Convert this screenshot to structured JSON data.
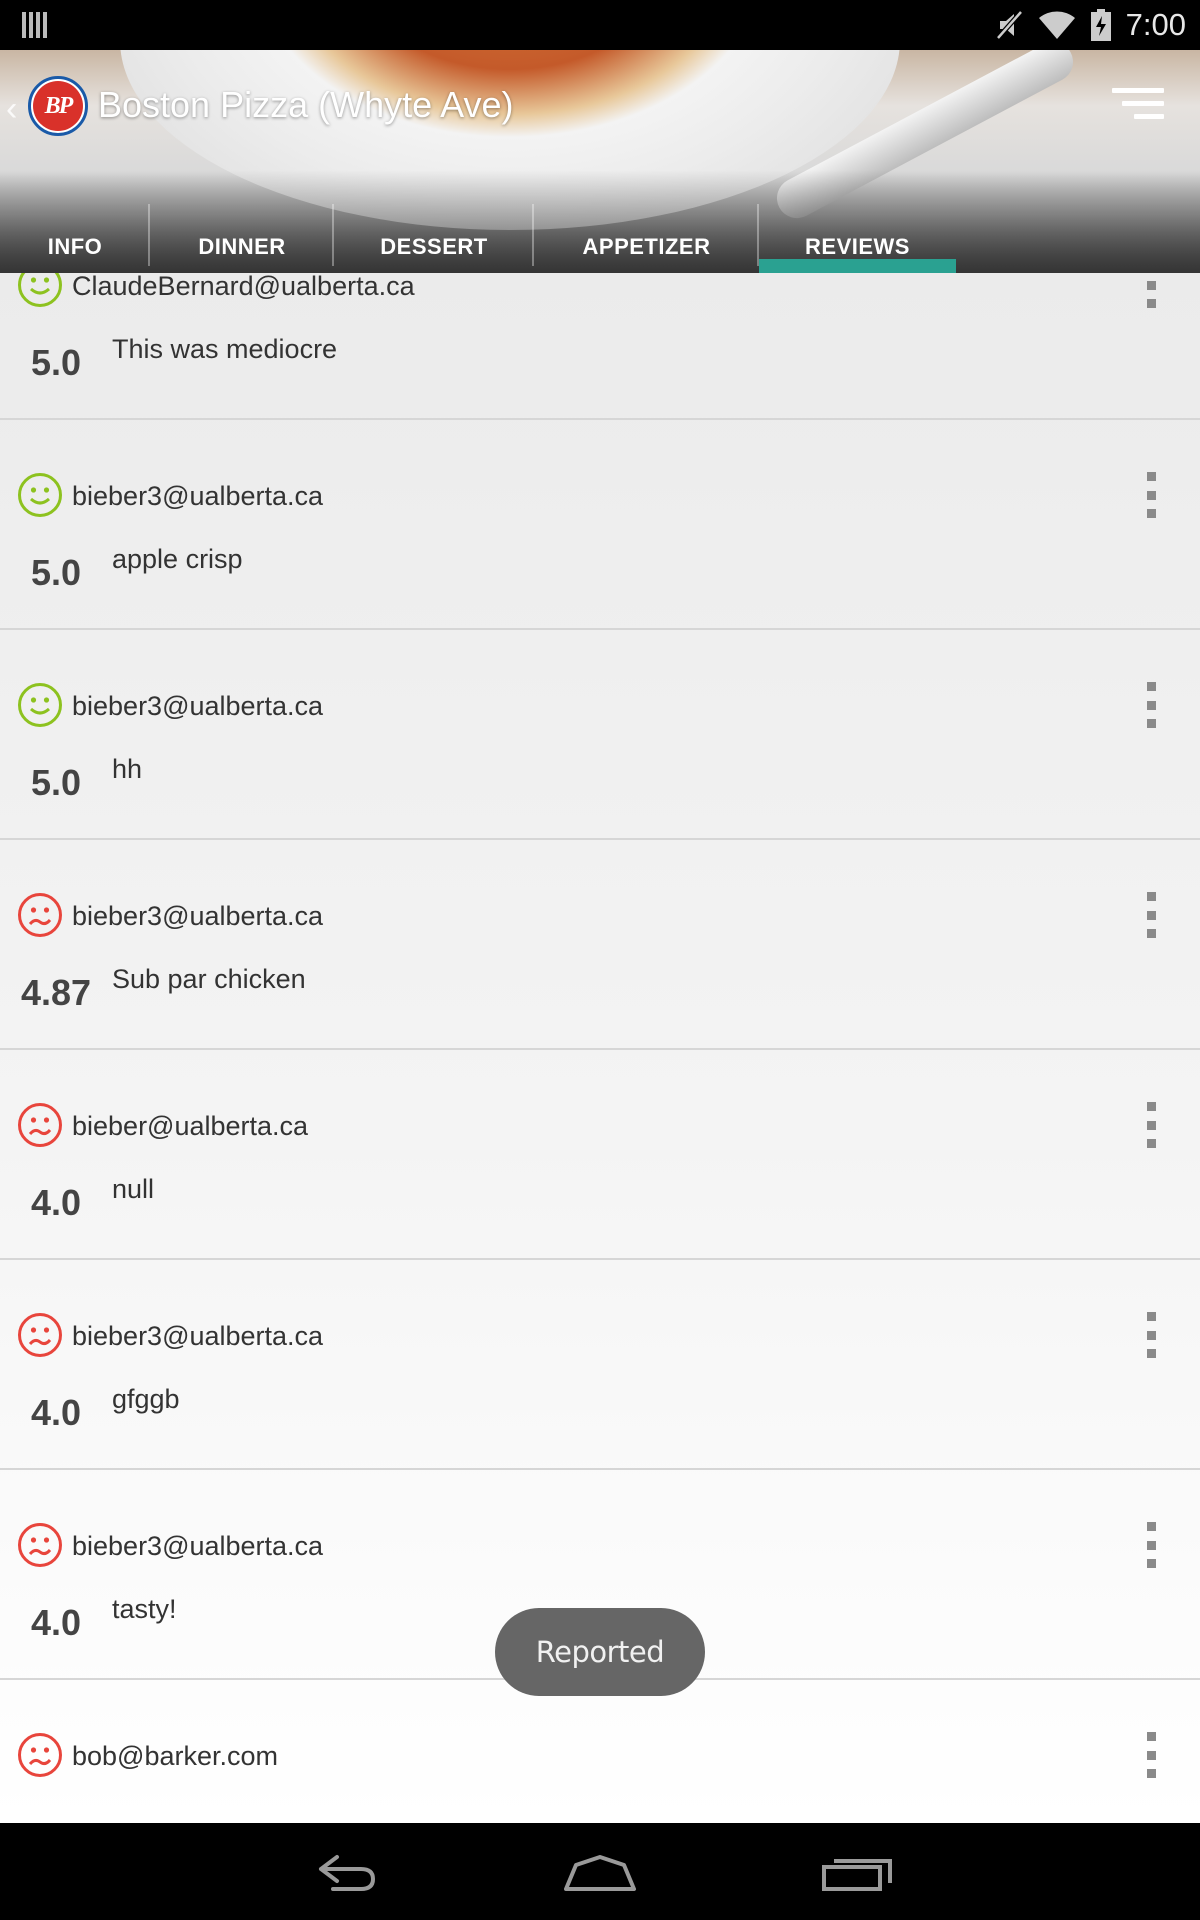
{
  "status_bar": {
    "time": "7:00",
    "icons": [
      "barcode-icon",
      "mute-icon",
      "wifi-icon",
      "battery-charging-icon"
    ]
  },
  "header": {
    "title": "Boston Pizza (Whyte Ave)",
    "logo_text": "BP",
    "menu_icon": "sort-menu-icon"
  },
  "tabs": [
    {
      "label": "INFO",
      "active": false
    },
    {
      "label": "DINNER",
      "active": false
    },
    {
      "label": "DESSERT",
      "active": false
    },
    {
      "label": "APPETIZER",
      "active": false
    },
    {
      "label": "REVIEWS",
      "active": true
    }
  ],
  "colors": {
    "accent": "#2aa191",
    "happy": "#8dc21f",
    "sad": "#e8453c"
  },
  "reviews": [
    {
      "email": "ClaudeBernard@ualberta.ca",
      "rating": "5.0",
      "comment": "This was mediocre",
      "sentiment": "happy"
    },
    {
      "email": "bieber3@ualberta.ca",
      "rating": "5.0",
      "comment": "apple crisp",
      "sentiment": "happy"
    },
    {
      "email": "bieber3@ualberta.ca",
      "rating": "5.0",
      "comment": "hh",
      "sentiment": "happy"
    },
    {
      "email": "bieber3@ualberta.ca",
      "rating": "4.87",
      "comment": "Sub par chicken",
      "sentiment": "sad"
    },
    {
      "email": "bieber@ualberta.ca",
      "rating": "4.0",
      "comment": "null",
      "sentiment": "sad"
    },
    {
      "email": "bieber3@ualberta.ca",
      "rating": "4.0",
      "comment": "gfggb",
      "sentiment": "sad"
    },
    {
      "email": "bieber3@ualberta.ca",
      "rating": "4.0",
      "comment": "tasty!",
      "sentiment": "sad"
    },
    {
      "email": "bob@barker.com",
      "rating": "",
      "comment": "",
      "sentiment": "sad"
    }
  ],
  "toast": "Reported",
  "nav_bar": [
    "back-icon",
    "home-icon",
    "recents-icon"
  ]
}
